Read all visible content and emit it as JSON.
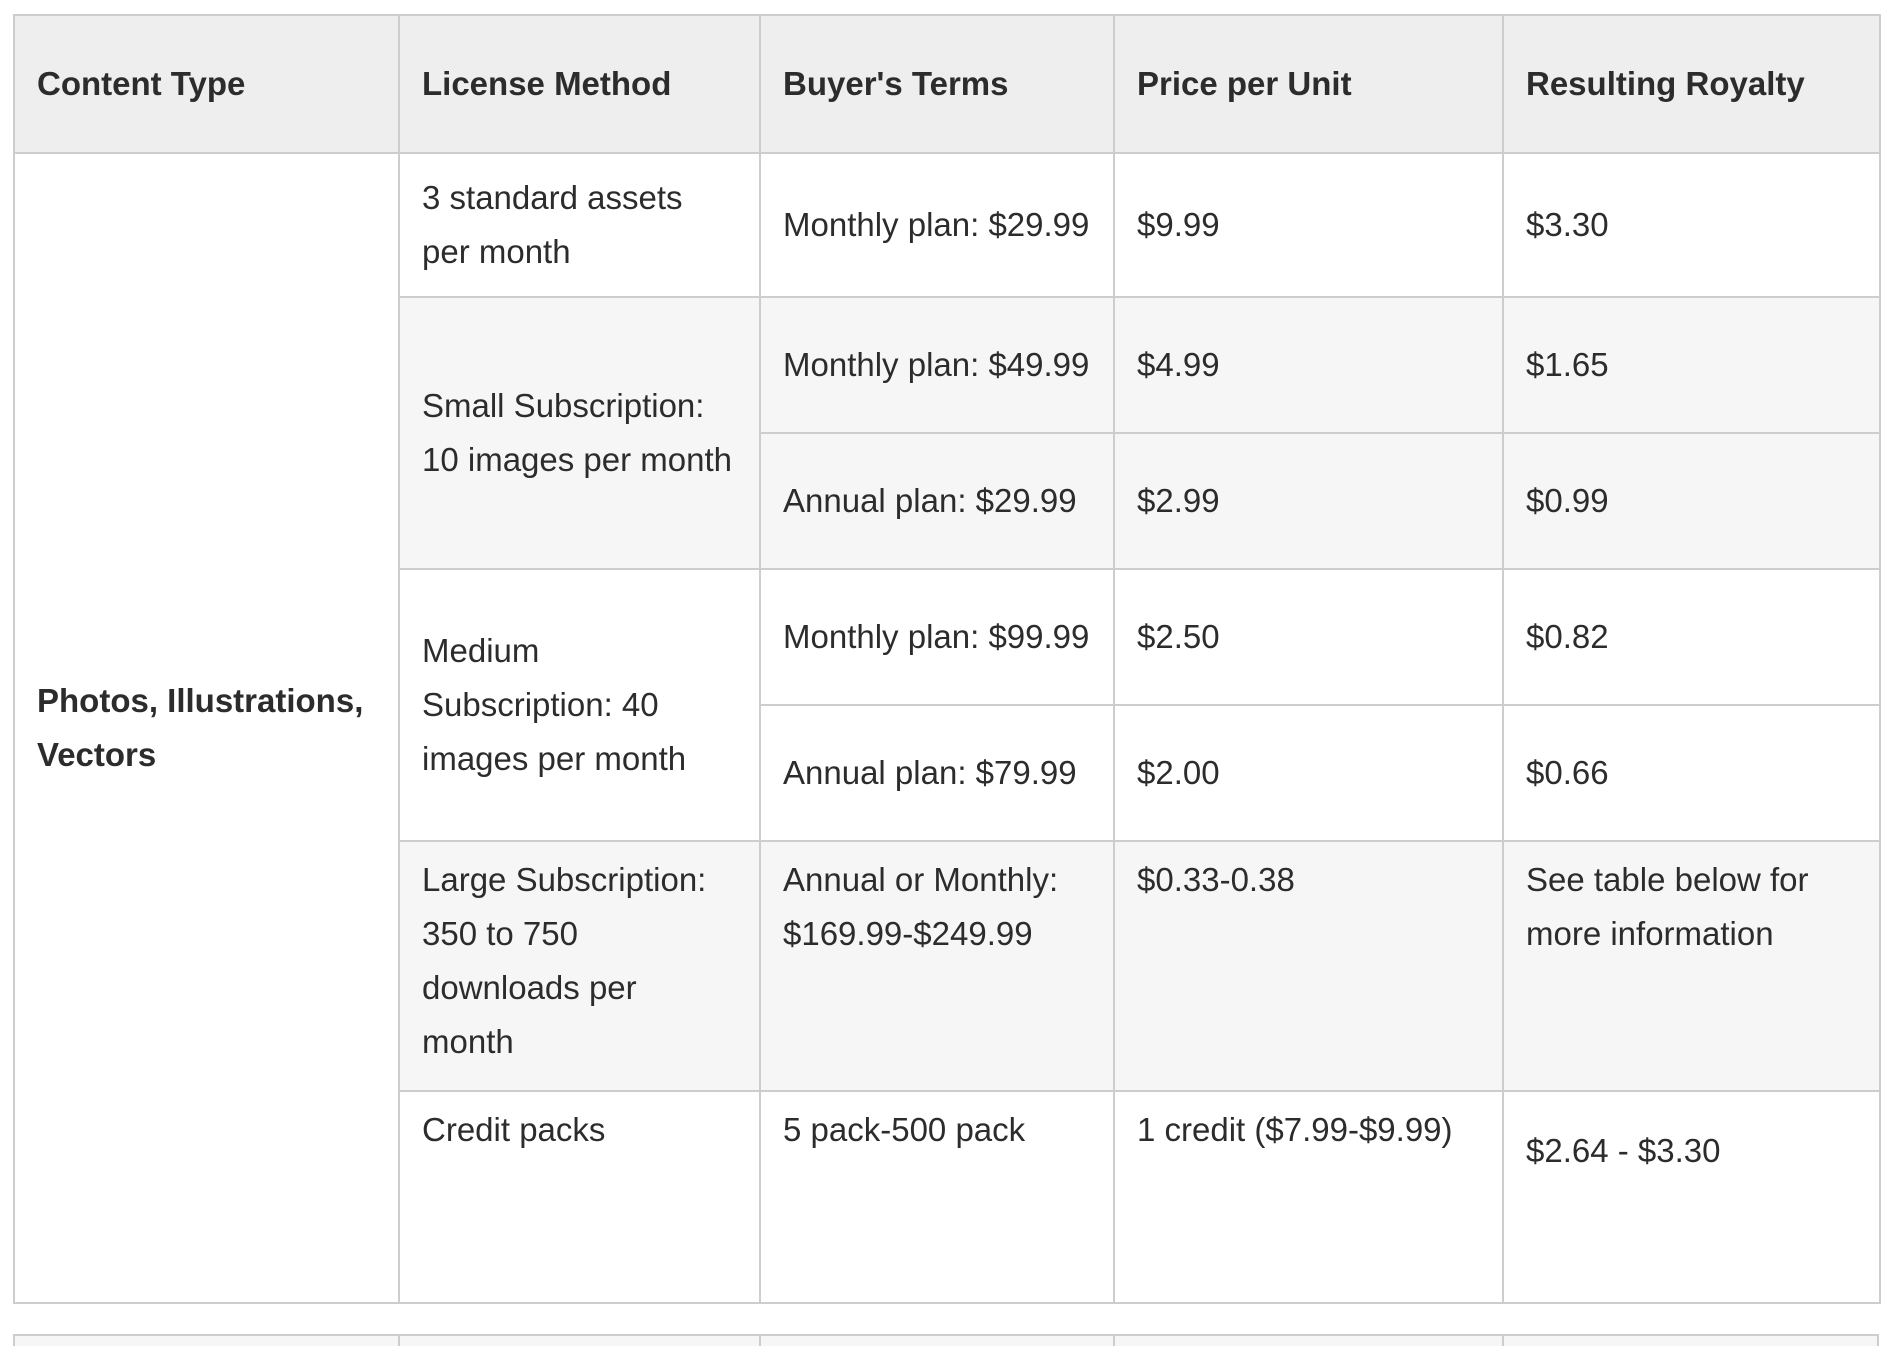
{
  "table": {
    "headers": [
      "Content Type",
      "License Method",
      "Buyer's Terms",
      "Price per Unit",
      "Resulting Royalty"
    ],
    "content_type": "Photos, Illustrations, Vectors",
    "rows": [
      {
        "license_method": "3 standard assets per month",
        "buyers_terms": "Monthly plan: $29.99",
        "price_per_unit": "$9.99",
        "resulting_royalty": "$3.30"
      },
      {
        "license_method": "Small Subscription: 10 images per month",
        "buyers_terms": "Monthly plan: $49.99",
        "price_per_unit": "$4.99",
        "resulting_royalty": "$1.65"
      },
      {
        "buyers_terms": "Annual plan: $29.99",
        "price_per_unit": "$2.99",
        "resulting_royalty": "$0.99"
      },
      {
        "license_method": "Medium Subscription: 40 images per month",
        "buyers_terms": "Monthly plan: $99.99",
        "price_per_unit": "$2.50",
        "resulting_royalty": "$0.82"
      },
      {
        "buyers_terms": "Annual plan: $79.99",
        "price_per_unit": "$2.00",
        "resulting_royalty": "$0.66"
      },
      {
        "license_method": "Large Subscription: 350 to 750 downloads per month",
        "buyers_terms": "Annual or Monthly: $169.99-$249.99",
        "price_per_unit": "$0.33-0.38",
        "resulting_royalty": "See table below for more information"
      },
      {
        "license_method": "Credit packs",
        "buyers_terms": "5 pack-500 pack",
        "price_per_unit": "1 credit ($7.99-$9.99)",
        "resulting_royalty": "$2.64 - $3.30"
      }
    ]
  }
}
